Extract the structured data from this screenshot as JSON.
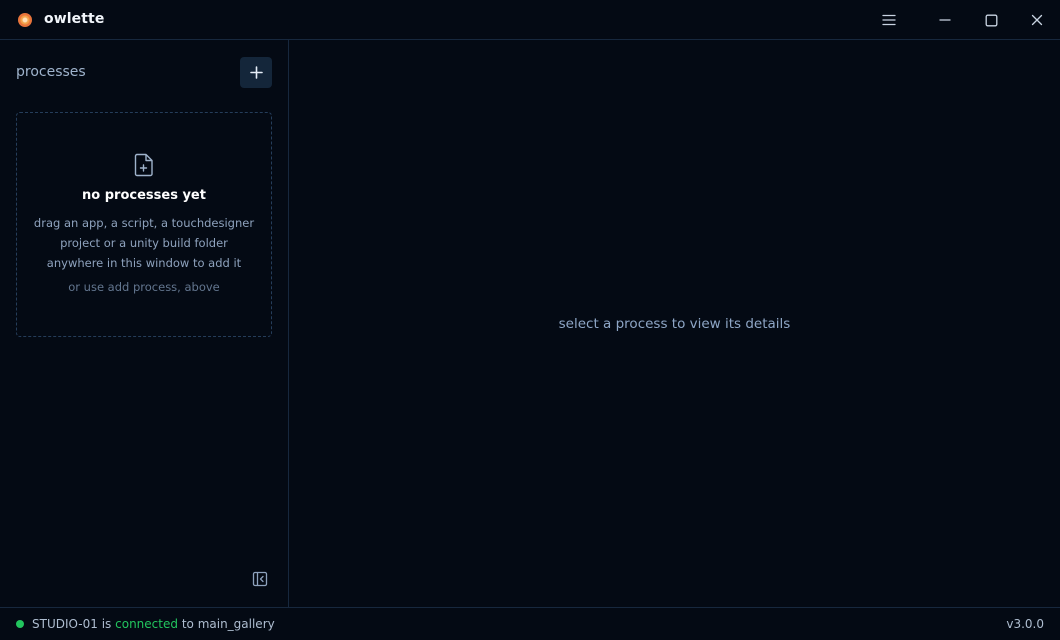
{
  "window": {
    "title": "owlette",
    "accent_color": "#e8743b"
  },
  "titlebar": {
    "icons": [
      "menu-icon",
      "minimize-icon",
      "maximize-icon",
      "close-icon"
    ]
  },
  "sidebar": {
    "title": "processes",
    "add_button_icon": "plus-icon",
    "empty_state": {
      "icon": "file-plus-icon",
      "title": "no processes yet",
      "description": "drag an app, a script, a touchdesigner project or a unity build folder anywhere in this window to add it",
      "hint": "or use add process, above"
    },
    "collapse_icon": "collapse-sidebar-icon"
  },
  "main": {
    "placeholder": "select a process to view its details"
  },
  "status": {
    "machine": "STUDIO-01",
    "is_word": "is",
    "state": "connected",
    "to_word": "to",
    "site": "main_gallery",
    "state_color": "#22c55e",
    "version": "v3.0.0"
  }
}
